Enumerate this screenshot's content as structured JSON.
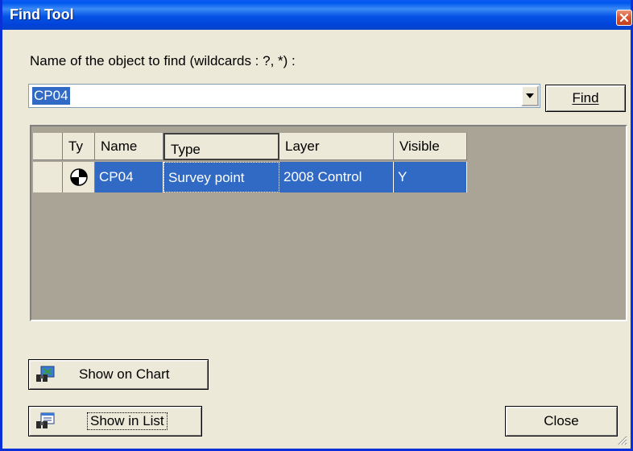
{
  "window": {
    "title": "Find Tool"
  },
  "search": {
    "label": "Name of the object to find (wildcards : ?, *) :",
    "value": "CP04",
    "find_label": "Find"
  },
  "grid": {
    "columns": [
      "Ty",
      "Name",
      "Type",
      "Layer",
      "Visible"
    ],
    "rows": [
      {
        "icon": "survey-point-icon",
        "name": "CP04",
        "type": "Survey point",
        "layer": "2008 Control",
        "visible": "Y"
      }
    ]
  },
  "buttons": {
    "show_on_chart": "Show on Chart",
    "show_in_list": "Show in List",
    "close": "Close"
  },
  "colors": {
    "title_bar": "#0058ee",
    "selection": "#316ac5",
    "dialog_bg": "#ece9d8",
    "grid_bg": "#a9a495"
  }
}
